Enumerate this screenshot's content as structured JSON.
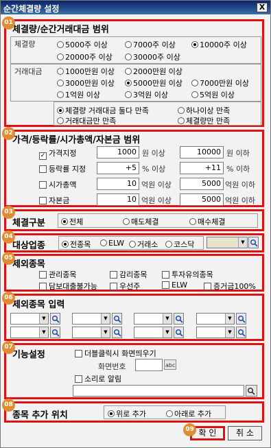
{
  "window": {
    "title": "순간체결량 설정",
    "close": "X"
  },
  "badges": [
    "01",
    "02",
    "03",
    "04",
    "05",
    "06",
    "07",
    "08",
    "09"
  ],
  "sec1": {
    "heading": "체결량/순간거래대금 범위",
    "volume_label": "체결량",
    "volume_options": [
      "5000주 이상",
      "7000주 이상",
      "10000주 이상",
      "20000주 이상",
      "30000주 이상"
    ],
    "volume_selected": 2,
    "amount_label": "거래대금",
    "amount_options": [
      "1000만원 이상",
      "2000만원 이상",
      "3000만원 이상",
      "5000만원 이상",
      "7000만원 이상",
      "1억원 이상",
      "3억원 이상",
      "5억원 이상"
    ],
    "amount_selected": 3,
    "cond_options": [
      "체결량 거래대금 둘다 만족",
      "하나이상 만족",
      "거래대금만 만족",
      "체결량만 만족"
    ],
    "cond_selected": 0
  },
  "sec2": {
    "heading": "가격/등락률/시가총액/자본금 범위",
    "rows": [
      {
        "label": "가격지정",
        "checked": true,
        "from": "1000",
        "from_unit": "원 이상",
        "to": "10000",
        "to_unit": "원 이하"
      },
      {
        "label": "등락률 지정",
        "checked": false,
        "from": "+5",
        "from_unit": "% 이상",
        "to": "+11",
        "to_unit": "% 이하"
      },
      {
        "label": "시가총액",
        "checked": false,
        "from": "10",
        "from_unit": "억원 이상",
        "to": "5000",
        "to_unit": "억원 이하"
      },
      {
        "label": "자본금",
        "checked": false,
        "from": "10",
        "from_unit": "억원 이상",
        "to": "5000",
        "to_unit": "억원 이하"
      }
    ]
  },
  "sec3": {
    "heading": "체결구분",
    "options": [
      "전체",
      "매도체결",
      "매수체결"
    ],
    "selected": 0
  },
  "sec4": {
    "heading": "대상업종",
    "options": [
      "전종목",
      "ELW",
      "거래소",
      "코스닥"
    ],
    "selected": 0
  },
  "sec5": {
    "heading": "제외종목",
    "options": [
      "관리종목",
      "감리종목",
      "투자유의종목",
      "담보대출불가능",
      "우선주",
      "ELW",
      "증거금100%"
    ]
  },
  "sec6": {
    "heading": "제외종목 입력"
  },
  "sec7": {
    "heading": "기능설정",
    "dblclick": "더블클릭시 화면띄우기",
    "screen_no_label": "화면번호",
    "sound": "소리로 알림"
  },
  "sec8": {
    "heading": "종목 추가 위치",
    "options": [
      "위로 추가",
      "아래로 추가"
    ],
    "selected": 0
  },
  "buttons": {
    "ok": "확 인",
    "cancel": "취 소"
  },
  "colors": {
    "highlight": "#dd1111",
    "badge": "#e08c33",
    "titlebar": "#0a246a"
  }
}
